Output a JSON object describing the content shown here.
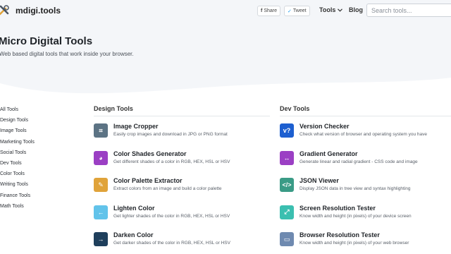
{
  "header": {
    "brand": "mdigi.tools",
    "share_label": "Share",
    "tweet_label": "Tweet",
    "nav_tools": "Tools",
    "nav_blog": "Blog",
    "search_placeholder": "Search tools..."
  },
  "hero": {
    "title": "Micro Digital Tools",
    "subtitle": "Web based digital tools that work inside your browser."
  },
  "sidebar": {
    "items": [
      "All Tools",
      "Design Tools",
      "Image Tools",
      "Marketing Tools",
      "Social Tools",
      "Dev Tools",
      "Color Tools",
      "Writing Tools",
      "Finance Tools",
      "Math Tools"
    ]
  },
  "design": {
    "title": "Design Tools",
    "tools": [
      {
        "name": "Image Cropper",
        "desc": "Easily crop images and download in JPG or PNG format",
        "color": "#5c7384",
        "icon": "crop-icon",
        "glyph": "⌗"
      },
      {
        "name": "Color Shades Generator",
        "desc": "Get different shades of a color in RGB, HEX, HSL or HSV",
        "color": "#9b3fc4",
        "icon": "palette-icon",
        "glyph": "◕"
      },
      {
        "name": "Color Palette Extractor",
        "desc": "Extract colors from an image and build a color palette",
        "color": "#e0a33a",
        "icon": "eyedropper-icon",
        "glyph": "✎"
      },
      {
        "name": "Lighten Color",
        "desc": "Get lighter shades of the color in RGB, HEX, HSL or HSV",
        "color": "#62c3ea",
        "icon": "arrow-left-icon",
        "glyph": "←"
      },
      {
        "name": "Darken Color",
        "desc": "Get darker shades of the color in RGB, HEX, HSL or HSV",
        "color": "#1f3f5c",
        "icon": "arrow-right-icon",
        "glyph": "→"
      }
    ]
  },
  "dev": {
    "title": "Dev Tools",
    "tools": [
      {
        "name": "Version Checker",
        "desc": "Check what version of browser and operating system you have",
        "color": "#1d5fd0",
        "icon": "version-icon",
        "glyph": "v?"
      },
      {
        "name": "Gradient Generator",
        "desc": "Generate linear and radial gradient - CSS code and image",
        "color": "#9b3fc4",
        "icon": "gradient-icon",
        "glyph": "↔"
      },
      {
        "name": "JSON Viewer",
        "desc": "Display JSON data in tree view and syntax highlighting",
        "color": "#3a9b86",
        "icon": "code-icon",
        "glyph": "</>"
      },
      {
        "name": "Screen Resolution Tester",
        "desc": "Know width and height (in pixels) of your device screen",
        "color": "#3bbfb0",
        "icon": "expand-icon",
        "glyph": "⤢"
      },
      {
        "name": "Browser Resolution Tester",
        "desc": "Know width and height (in pixels) of your web browser",
        "color": "#6f8ab0",
        "icon": "browser-icon",
        "glyph": "▭"
      }
    ]
  }
}
